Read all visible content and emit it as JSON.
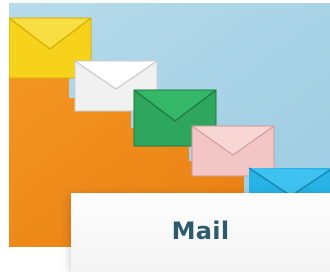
{
  "tile": {
    "label": "Mail",
    "icon": "envelope-staircase-photo"
  },
  "colors": {
    "sky": "#a9d3e7",
    "orange": "#f28b1c",
    "yellow_envelope": "#f6d21a",
    "white_envelope": "#f3f3f3",
    "green_envelope": "#2ea65d",
    "pink_envelope": "#f2c6c4",
    "blue_envelope": "#27b3e6",
    "label_text": "#2c5a6e"
  }
}
